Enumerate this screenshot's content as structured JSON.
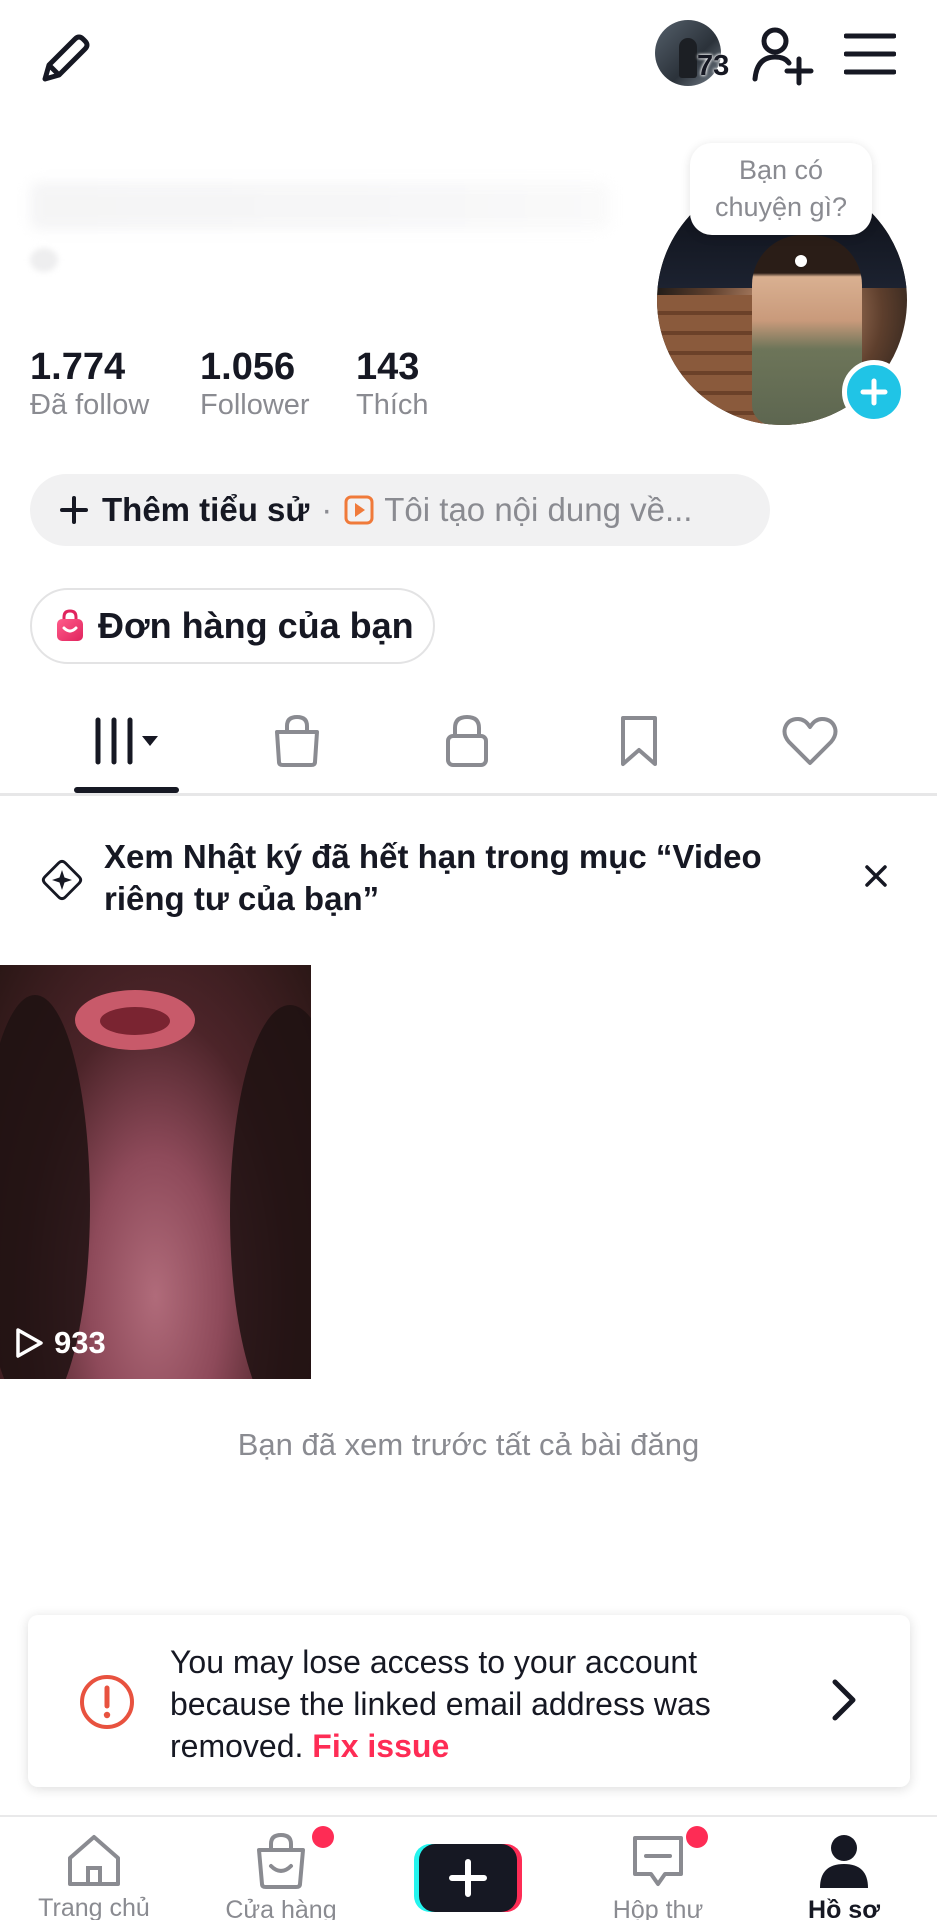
{
  "header": {
    "story_count": "73",
    "icons": [
      "edit-icon",
      "add-user-icon",
      "menu-icon"
    ]
  },
  "profile": {
    "bubble_text": [
      "Bạn có",
      "chuyện gì?"
    ],
    "stats": [
      {
        "value": "1.774",
        "label": "Đã follow"
      },
      {
        "value": "1.056",
        "label": "Follower"
      },
      {
        "value": "143",
        "label": "Thích"
      }
    ],
    "add_bio_label": "Thêm tiểu sử",
    "bio_separator": "·",
    "bio_placeholder": "Tôi tạo nội dung về...",
    "orders_label": "Đơn hàng của bạn"
  },
  "tabs": [
    "videos-grid-icon",
    "shop-bag-icon",
    "lock-icon",
    "bookmark-icon",
    "heart-icon"
  ],
  "banner": {
    "text": "Xem Nhật ký đã hết hạn trong mục “Video riêng tư của bạn”"
  },
  "videos": [
    {
      "views": "933"
    }
  ],
  "end_message": "Bạn đã xem trước tất cả bài đăng",
  "warning": {
    "text": "You may lose access to your account because the linked email address was removed.",
    "fix_label": "Fix issue"
  },
  "bottom_nav": [
    {
      "label": "Trang chủ",
      "icon": "home-icon"
    },
    {
      "label": "Cửa hàng",
      "icon": "shop-icon"
    },
    {
      "label": "",
      "icon": "create-plus-icon"
    },
    {
      "label": "Hộp thư",
      "icon": "inbox-icon"
    },
    {
      "label": "Hồ sơ",
      "icon": "profile-icon"
    }
  ],
  "colors": {
    "accent_red": "#fe2c55",
    "accent_cyan": "#20c4e6",
    "text_primary": "#161823",
    "text_secondary": "#8a8b91"
  }
}
